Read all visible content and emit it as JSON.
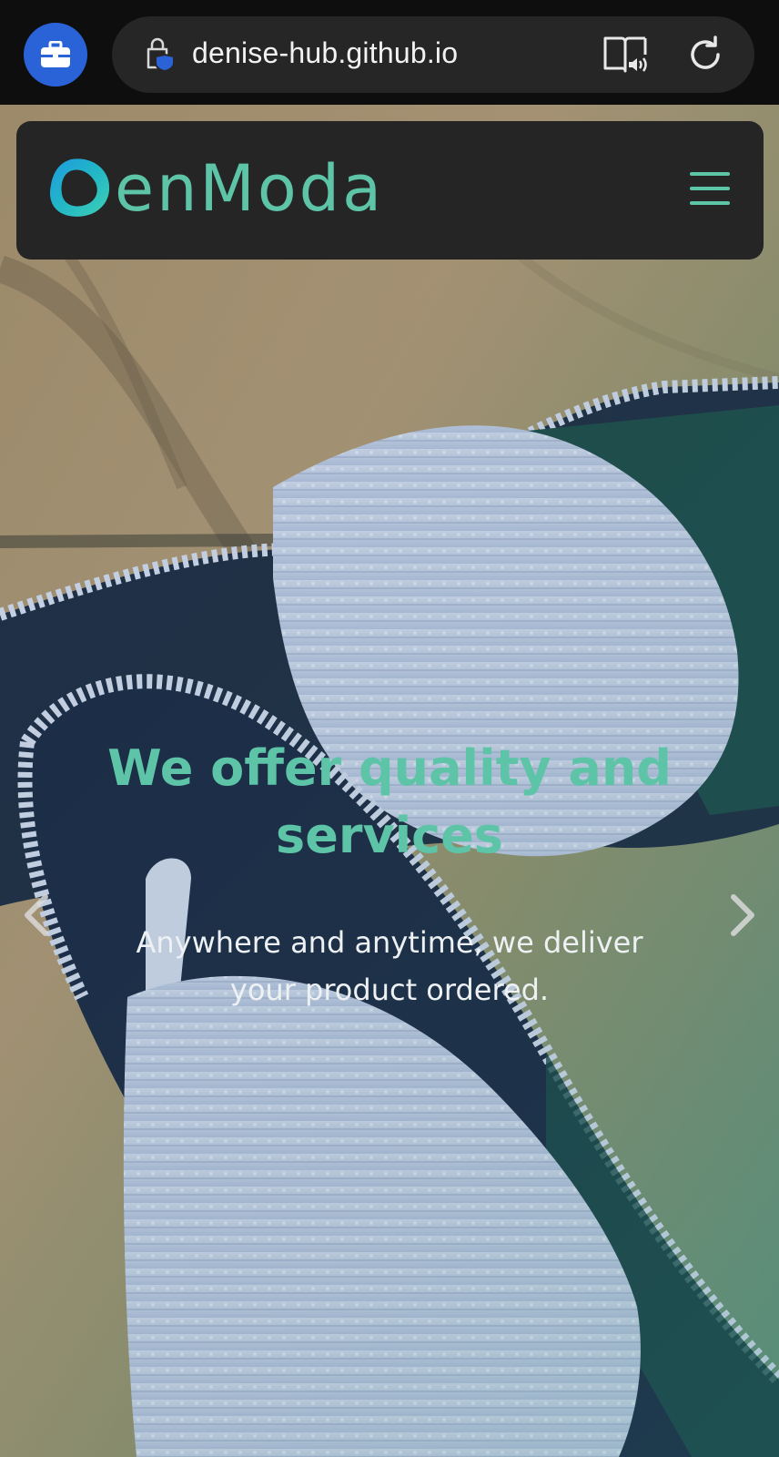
{
  "browser": {
    "url": "denise-hub.github.io",
    "icons": {
      "profile": "briefcase-icon",
      "lock": "lock-shield-icon",
      "reader": "reader-audio-icon",
      "reload": "reload-icon"
    }
  },
  "navbar": {
    "brand_name": "enModa",
    "logo": "brand-logo-icon",
    "menu_icon": "hamburger-menu-icon"
  },
  "carousel": {
    "title": "We offer quality and services",
    "subtitle": "Anywhere and anytime, we deliver your product ordered.",
    "prev_icon": "chevron-left-icon",
    "next_icon": "chevron-right-icon"
  },
  "colors": {
    "accent": "#5ec4a7",
    "navbar_bg": "#252525",
    "browser_bg": "#0e0e0e",
    "url_pill_bg": "#262626",
    "profile_bg": "#2a63d8"
  }
}
